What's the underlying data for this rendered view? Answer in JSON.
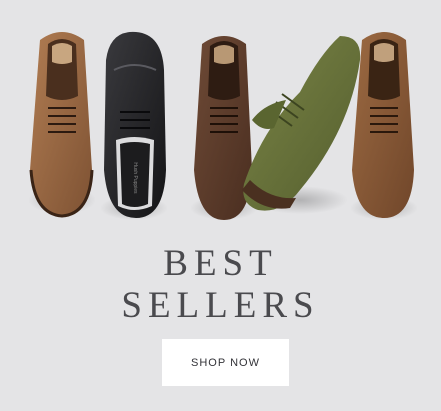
{
  "banner": {
    "headline_line1": "BEST",
    "headline_line2": "SELLERS",
    "cta_label": "SHOP NOW",
    "cta_aria": "SHOP NOW"
  },
  "colors": {
    "background": "#e4e4e6",
    "headline": "#4a4a4e",
    "button_bg": "#ffffff",
    "button_text": "#333338"
  },
  "products_image": {
    "shoes": [
      {
        "name": "tan-leather-derby-shoe",
        "color": "#9a6a45"
      },
      {
        "name": "black-leather-derby-shoe",
        "color": "#1e1e20"
      },
      {
        "name": "brown-suede-derby-shoe",
        "color": "#5a3a2a"
      },
      {
        "name": "olive-suede-derby-shoe",
        "color": "#65703a"
      },
      {
        "name": "tan-suede-derby-shoe",
        "color": "#8a5a36"
      }
    ]
  }
}
